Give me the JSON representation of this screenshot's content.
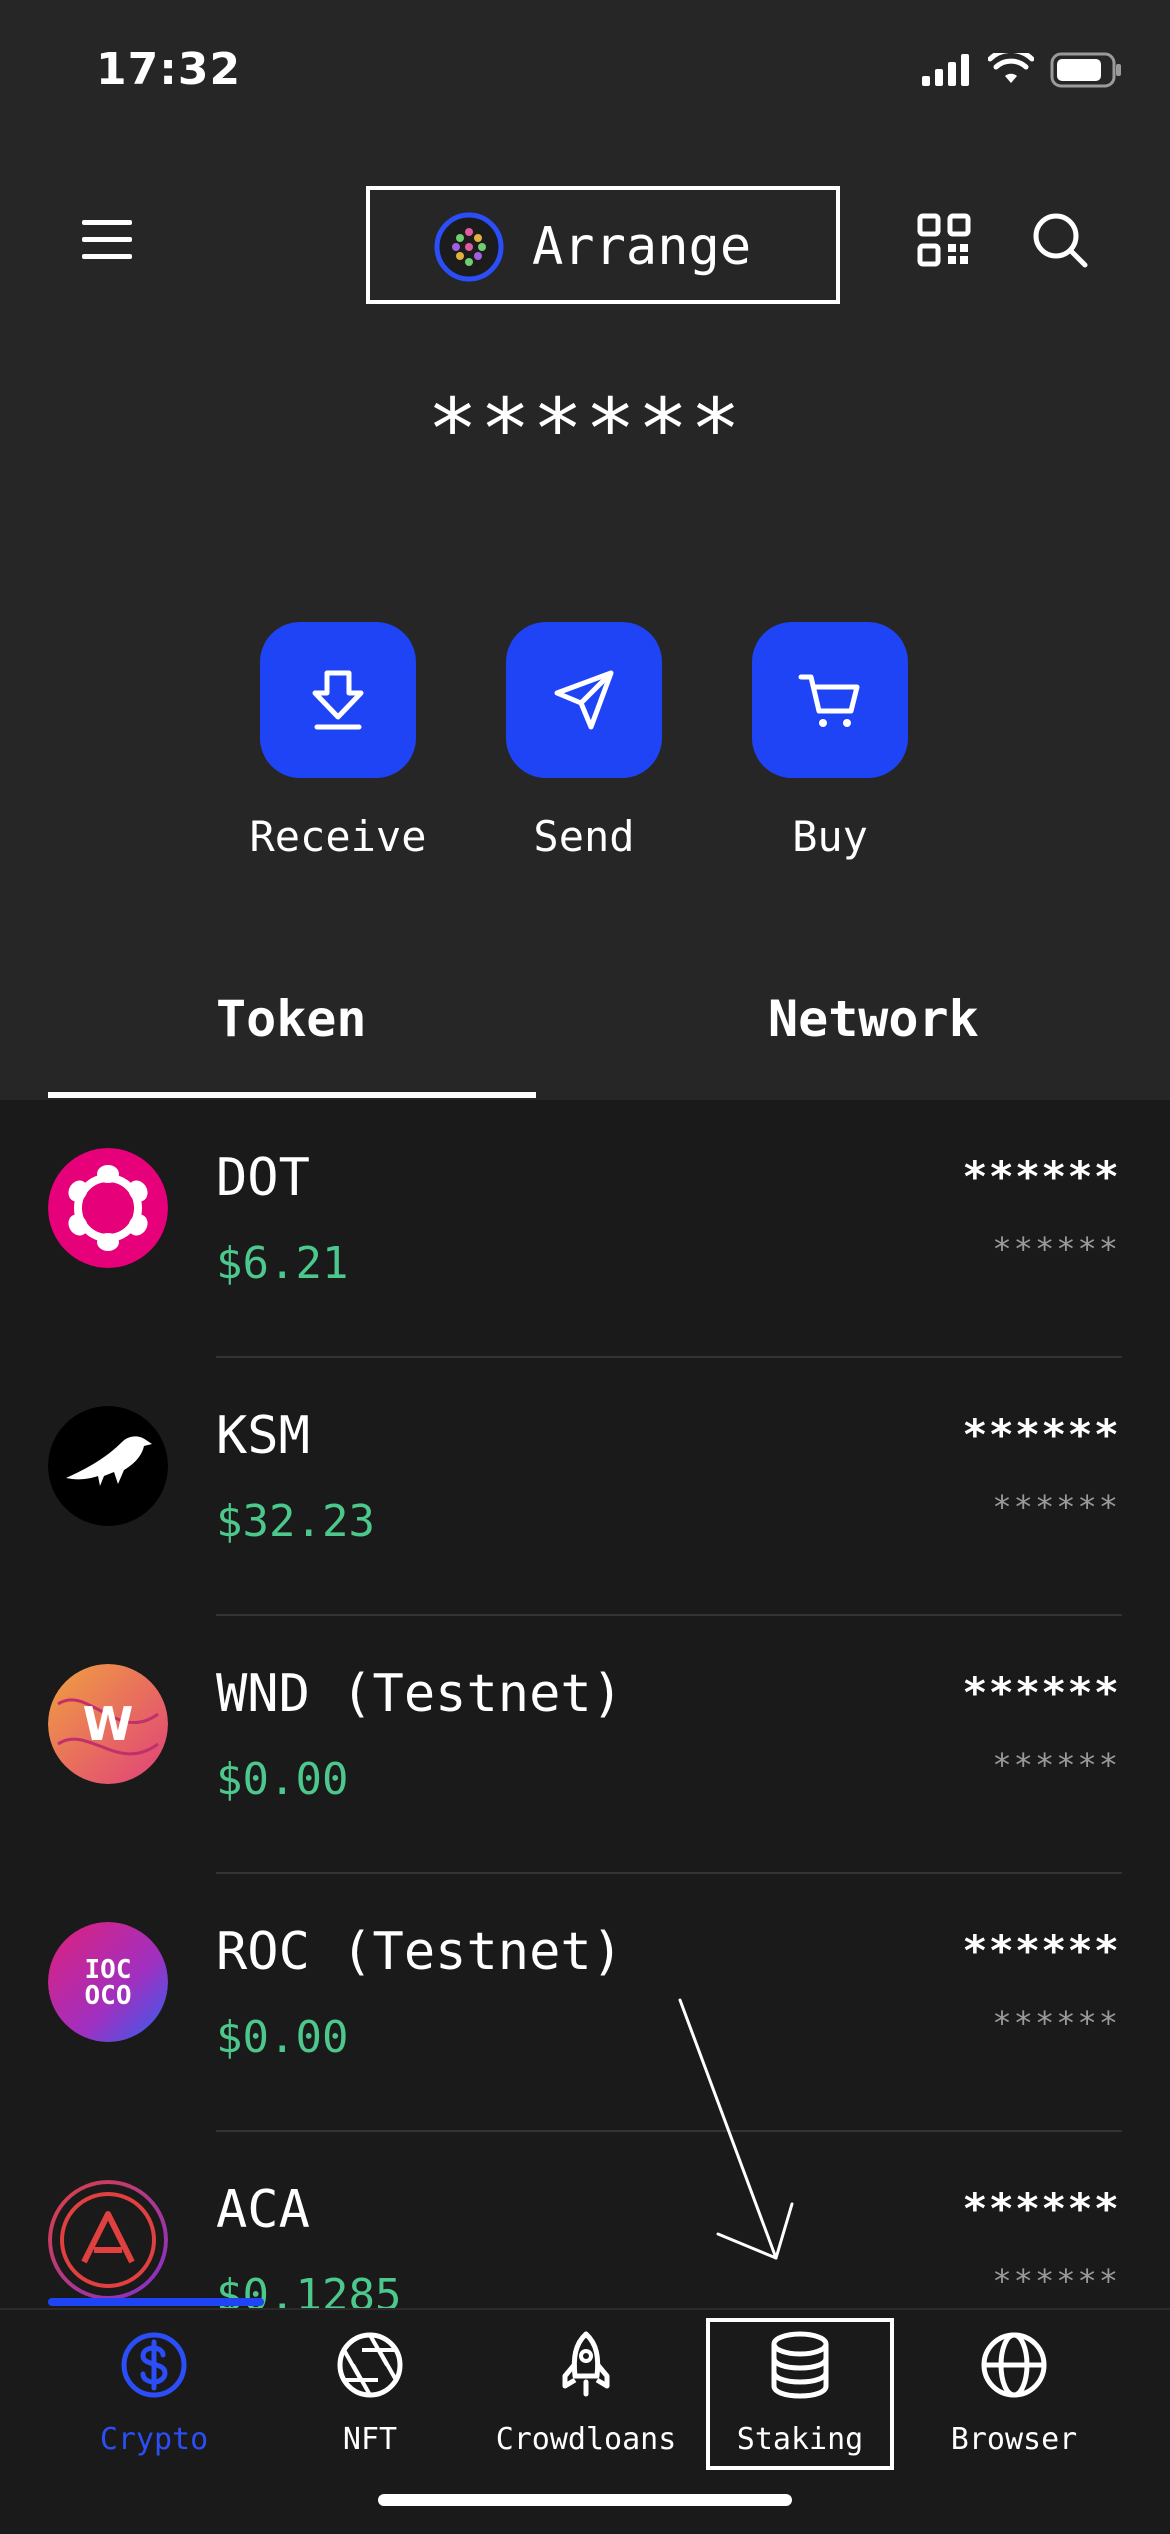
{
  "status_bar": {
    "time": "17:32"
  },
  "header": {
    "account_name": "Arrange",
    "balance": "******"
  },
  "actions": [
    {
      "label": "Receive"
    },
    {
      "label": "Send"
    },
    {
      "label": "Buy"
    }
  ],
  "tabs": [
    {
      "label": "Token",
      "active": true
    },
    {
      "label": "Network",
      "active": false
    }
  ],
  "tokens": [
    {
      "name": "DOT",
      "price": "$6.21",
      "balance": "******",
      "value": "******"
    },
    {
      "name": "KSM",
      "price": "$32.23",
      "balance": "******",
      "value": "******"
    },
    {
      "name": "WND (Testnet)",
      "price": "$0.00",
      "balance": "******",
      "value": "******"
    },
    {
      "name": "ROC (Testnet)",
      "price": "$0.00",
      "balance": "******",
      "value": "******"
    },
    {
      "name": "ACA",
      "price": "$0.1285",
      "balance": "******",
      "value": "******"
    }
  ],
  "nav": [
    {
      "label": "Crypto",
      "icon": "dollar-icon",
      "active": true
    },
    {
      "label": "NFT",
      "icon": "aperture-icon",
      "active": false
    },
    {
      "label": "Crowdloans",
      "icon": "rocket-icon",
      "active": false
    },
    {
      "label": "Staking",
      "icon": "database-icon",
      "active": false
    },
    {
      "label": "Browser",
      "icon": "globe-icon",
      "active": false
    }
  ],
  "colors": {
    "accent": "#1f44f6",
    "price_green": "#4cc88c",
    "background": "#1a1a1a",
    "header_bg": "#262626"
  }
}
